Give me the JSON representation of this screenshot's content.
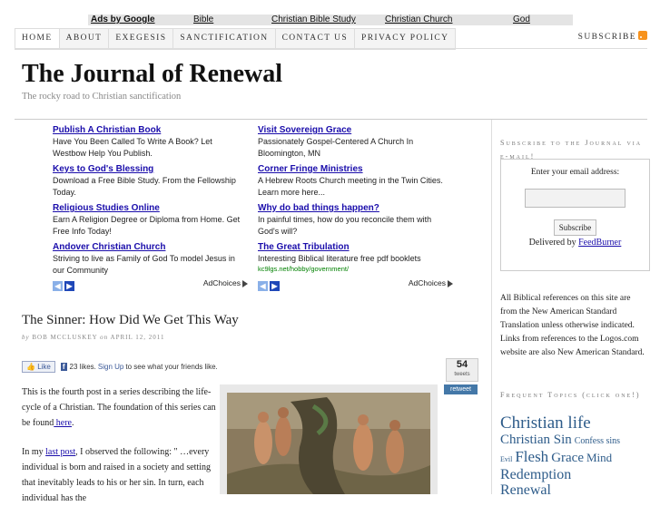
{
  "ad_links_bar": {
    "lead": "Ads by Google",
    "links": [
      "Bible",
      "Christian Bible Study",
      "Christian Church",
      "God"
    ]
  },
  "nav": {
    "items": [
      "HOME",
      "ABOUT",
      "EXEGESIS",
      "SANCTIFICATION",
      "CONTACT US",
      "PRIVACY POLICY"
    ],
    "subscribe": "SUBSCRIBE"
  },
  "site": {
    "title": "The Journal of Renewal",
    "tagline": "The rocky road to Christian sanctification"
  },
  "ads": {
    "left": [
      {
        "title": "Publish A Christian Book",
        "desc": "Have You Been Called To Write A Book? Let Westbow Help You Publish."
      },
      {
        "title": "Keys to God's Blessing",
        "desc": "Download a Free Bible Study. From the Fellowship Today."
      },
      {
        "title": "Religious Studies Online",
        "desc": "Earn A Religion Degree or Diploma from Home. Get Free Info Today!"
      },
      {
        "title": "Andover Christian Church",
        "desc": "Striving to live as Family of God To model Jesus in our Community"
      }
    ],
    "right": [
      {
        "title": "Visit Sovereign Grace",
        "desc": "Passionately Gospel-Centered A Church In Bloomington, MN"
      },
      {
        "title": "Corner Fringe Ministries",
        "desc": "A Hebrew Roots Church meeting in the Twin Cities. Learn more here..."
      },
      {
        "title": "Why do bad things happen?",
        "desc": "In painful times, how do you reconcile them with God's will?"
      },
      {
        "title": "The Great Tribulation",
        "desc": "Interesting Biblical literature free pdf booklets",
        "url": "kc9lgs.net/hobby/government/"
      }
    ],
    "adchoices": "AdChoices"
  },
  "post": {
    "title": "The Sinner: How Did We Get This Way",
    "byline_prefix": "by",
    "author": "BOB MCCLUSKEY",
    "byline_on": "on",
    "date": "APRIL 12, 2011",
    "fb_like": "Like",
    "fb_count": "f",
    "fb_text": "23 likes.",
    "fb_signup": "Sign Up",
    "fb_rest": "to see what your friends like.",
    "tweet_count": "54",
    "tweet_label": "tweets",
    "retweet": "retweet",
    "para1_pre": "This is the fourth post in a series describing the life-cycle of a Christian. The foundation of this series can be found",
    "para1_link": " here",
    "para1_post": ".",
    "para2_pre": "In my ",
    "para2_link": "last post",
    "para2_post": ", I observed the following: \" …every individual is born and raised in a society and setting that inevitably leads to his or her sin. In turn, each individual has the"
  },
  "sidebar": {
    "subscribe_head": "Subscribe to the Journal via e-mail!",
    "email_label": "Enter your email address:",
    "subscribe_btn": "Subscribe",
    "delivered_pre": "Delivered by ",
    "feedburner": "FeedBurner",
    "biblical_note": "All Biblical references on this site are from the New American Standard Translation unless otherwise indicated. Links from references to the Logos.com website are also New American Standard.",
    "topics_head": "Frequent Topics (click one!)",
    "tags": [
      "Christian life",
      "Christian Sin",
      "Confess sins",
      "Evil",
      "Flesh",
      "Grace",
      "Mind",
      "Redemption",
      "Renewal"
    ]
  },
  "colors": {
    "link": "#1a0dab",
    "tag": "#2e5c8a",
    "ad_url": "#008000",
    "rss": "#f7931e",
    "facebook": "#3b5998",
    "retweet": "#4478a8"
  }
}
